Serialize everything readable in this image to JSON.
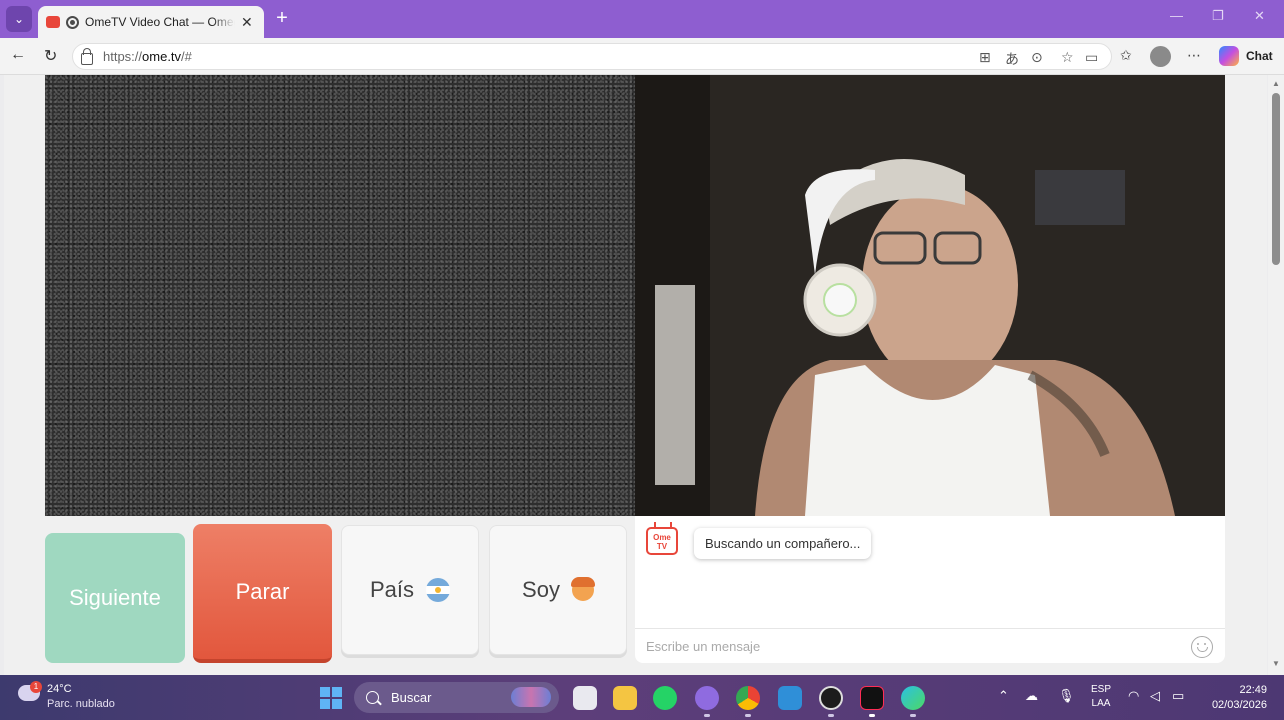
{
  "browser": {
    "tab_title": "OmeTV Video Chat — Omegle",
    "new_tab": "+",
    "url_protocol": "https://",
    "url_host": "ome.tv",
    "url_rest": "/#",
    "chat_button_label": "Chat",
    "window_controls": [
      "—",
      "❐",
      "✕"
    ]
  },
  "controls": {
    "next_label": "Siguiente",
    "stop_label": "Parar",
    "country_label": "País",
    "gender_label": "Soy"
  },
  "chat": {
    "logo_text": "Ome TV",
    "status_message": "Buscando un compañero...",
    "input_placeholder": "Escribe un mensaje"
  },
  "taskbar": {
    "weather_badge": "1",
    "weather_temp": "24°C",
    "weather_desc": "Parc. nublado",
    "search_label": "Buscar",
    "lang_line1": "ESP",
    "lang_line2": "LAA",
    "time": "22:49",
    "date": "02/03/2026"
  },
  "colors": {
    "titlebar": "#8e5ed0",
    "next_button": "#9fd8c0",
    "stop_button": "#e2573d"
  }
}
